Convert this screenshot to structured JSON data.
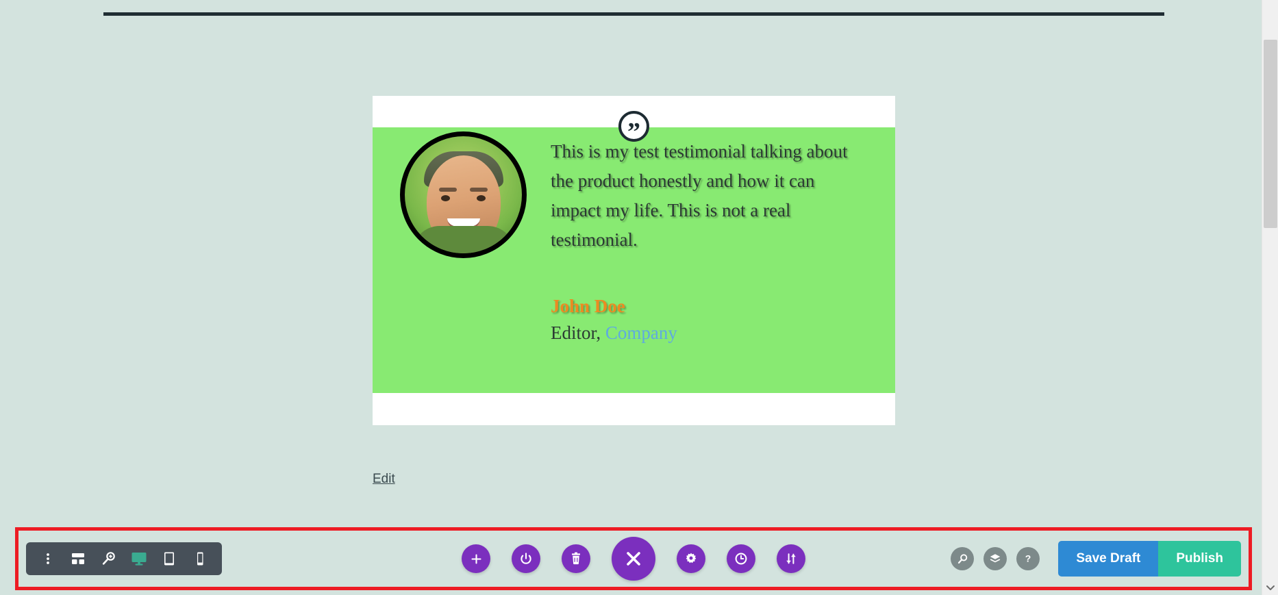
{
  "page": {
    "background_color": "#d3e3de",
    "divider_color": "#1f2d33"
  },
  "testimonial": {
    "card_background": "#ffffff",
    "body_background": "#88ea72",
    "quote_icon": "quote-mark-icon",
    "quote_glyph": "”",
    "avatar_alt": "author-portrait",
    "quote_text": "This is my test testimonial talking about the product honestly and how it can impact my life. This is not a real testimonial.",
    "author_name": "John Doe",
    "author_role_prefix": "Editor, ",
    "author_company": "Company",
    "author_name_color": "#ec8b22",
    "company_color": "#5faae0"
  },
  "edit_link": {
    "label": "Edit"
  },
  "toolbar": {
    "highlight_color": "#ed1c24",
    "panel_background": "#475059",
    "device_modes": [
      {
        "name": "more-options-icon",
        "label": "Options",
        "active": false
      },
      {
        "name": "wireframe-icon",
        "label": "Wireframe View",
        "active": false
      },
      {
        "name": "zoom-out-icon",
        "label": "Zoom Out",
        "active": false
      },
      {
        "name": "desktop-icon",
        "label": "Desktop View",
        "active": true
      },
      {
        "name": "tablet-icon",
        "label": "Tablet View",
        "active": false
      },
      {
        "name": "mobile-icon",
        "label": "Phone View",
        "active": false
      }
    ],
    "active_device_color": "#3aab90",
    "center_actions": [
      {
        "name": "add-icon",
        "label": "Add New Section"
      },
      {
        "name": "power-icon",
        "label": "Toggle Builder"
      },
      {
        "name": "trash-icon",
        "label": "Clear Layout"
      },
      {
        "name": "close-icon",
        "label": "Close Settings"
      },
      {
        "name": "gear-icon",
        "label": "Page Settings"
      },
      {
        "name": "history-clock-icon",
        "label": "Editing History"
      },
      {
        "name": "sort-arrows-icon",
        "label": "Portability"
      }
    ],
    "center_button_color": "#7b2fbe",
    "right_icons": [
      {
        "name": "search-icon",
        "label": "Search"
      },
      {
        "name": "layers-icon",
        "label": "Layers"
      },
      {
        "name": "help-icon",
        "label": "Help"
      }
    ],
    "right_icon_color": "#7d8a8a",
    "save_draft_label": "Save Draft",
    "save_draft_color": "#2e8ad4",
    "publish_label": "Publish",
    "publish_color": "#2ec49c"
  },
  "scrollbar": {
    "name": "vertical-scrollbar",
    "thumb_color": "#cdcdcd",
    "down_arrow": "chevron-down-icon"
  }
}
